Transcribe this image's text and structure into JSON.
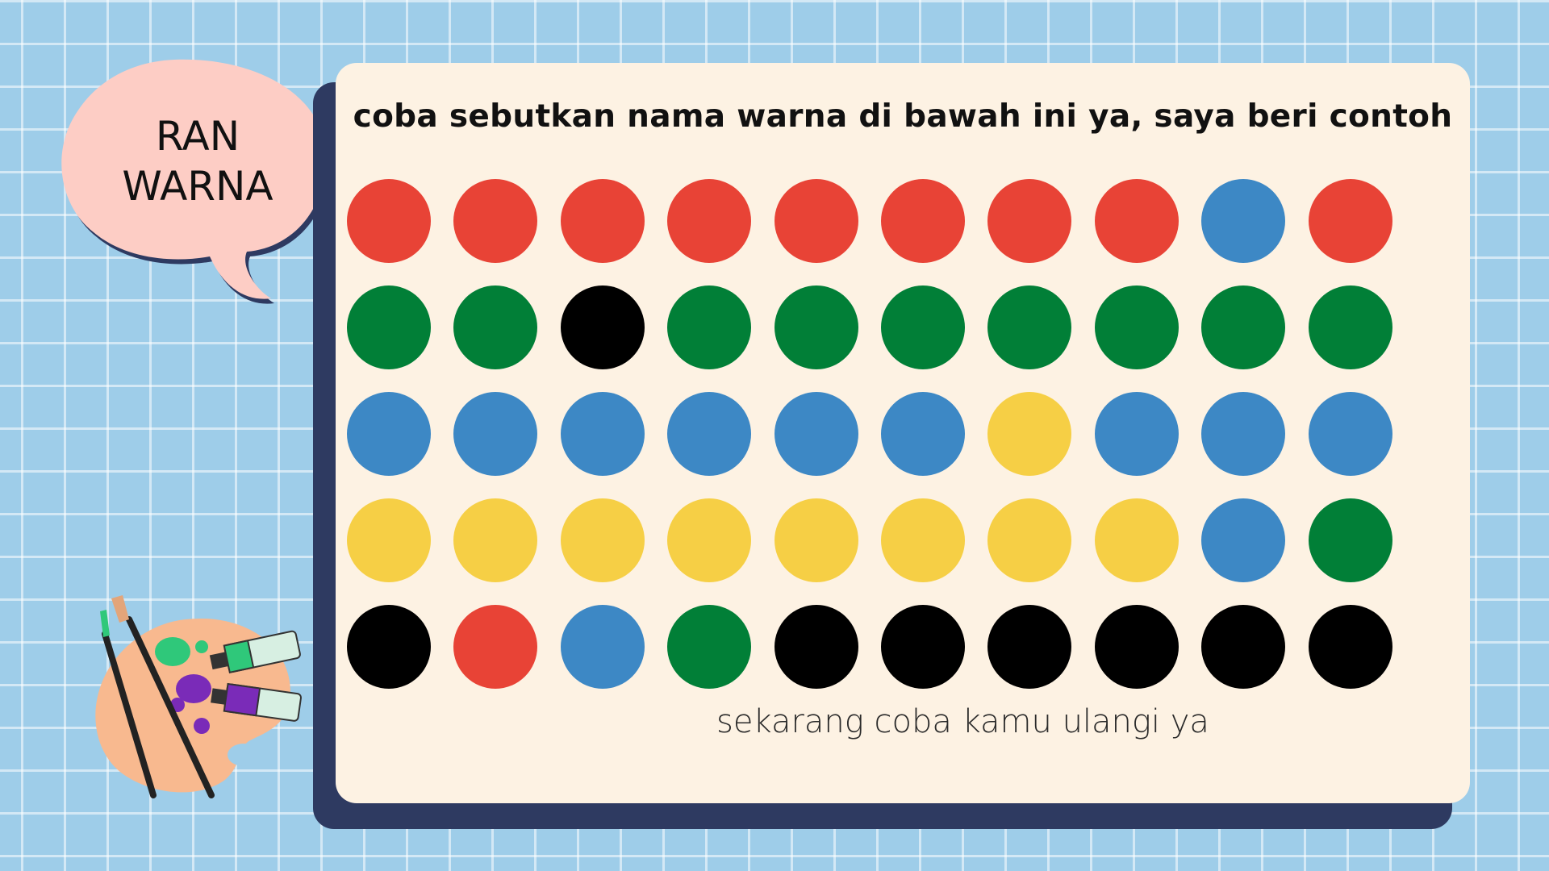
{
  "bubble": {
    "line1": "RAN",
    "line2": "WARNA"
  },
  "instruction": "coba sebutkan nama warna di bawah ini ya, saya beri contoh",
  "footer": "sekarang coba kamu ulangi ya",
  "colors": {
    "red": "#e84336",
    "green": "#017f37",
    "blue": "#3d88c5",
    "yellow": "#f6cf45",
    "black": "#000000"
  },
  "rows": [
    [
      "red",
      "red",
      "red",
      "red",
      "red",
      "red",
      "red",
      "red",
      "blue",
      "red"
    ],
    [
      "green",
      "green",
      "black",
      "green",
      "green",
      "green",
      "green",
      "green",
      "green",
      "green"
    ],
    [
      "blue",
      "blue",
      "blue",
      "blue",
      "blue",
      "blue",
      "yellow",
      "blue",
      "blue",
      "blue"
    ],
    [
      "yellow",
      "yellow",
      "yellow",
      "yellow",
      "yellow",
      "yellow",
      "yellow",
      "yellow",
      "blue",
      "green"
    ],
    [
      "black",
      "red",
      "blue",
      "green",
      "black",
      "black",
      "black",
      "black",
      "black",
      "black"
    ]
  ],
  "decorations": [
    "speech-bubble",
    "paint-palette-icon"
  ]
}
